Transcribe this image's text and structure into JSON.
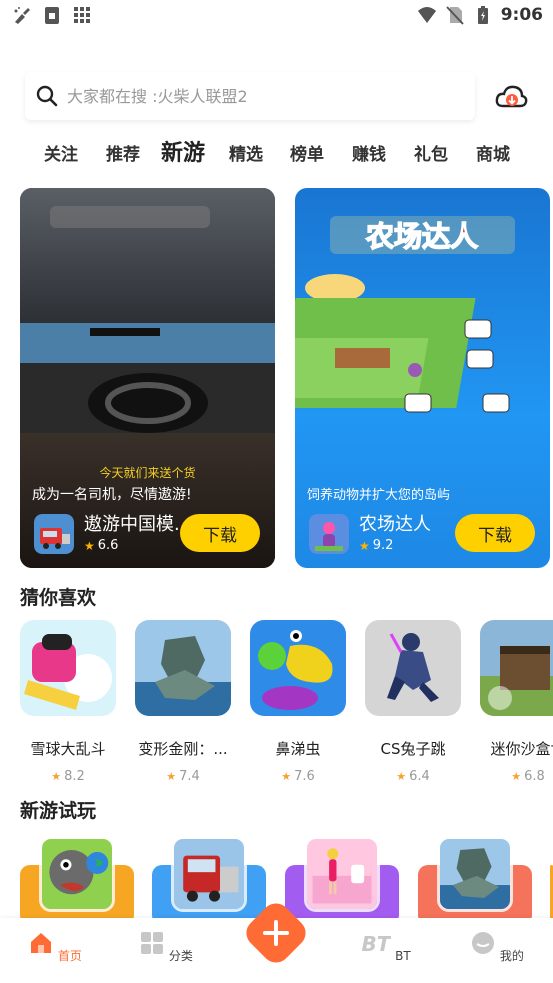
{
  "status_bar": {
    "time": "9:06",
    "left_icons": [
      "broom-icon",
      "sim-card-icon",
      "grid-icon"
    ],
    "right_icons": [
      "wifi-icon",
      "no-sim-icon",
      "battery-icon"
    ]
  },
  "search": {
    "placeholder": "大家都在搜 :火柴人联盟2",
    "icon": "search-icon",
    "right_icon": "cloud-download-icon"
  },
  "tabs": [
    {
      "label": "关注",
      "active": false
    },
    {
      "label": "推荐",
      "active": false
    },
    {
      "label": "新游",
      "active": true
    },
    {
      "label": "精选",
      "active": false
    },
    {
      "label": "榜单",
      "active": false
    },
    {
      "label": "赚钱",
      "active": false
    },
    {
      "label": "礼包",
      "active": false
    },
    {
      "label": "商城",
      "active": false
    }
  ],
  "banners": [
    {
      "overlay_text": "今天就们来送个货",
      "description": "成为一名司机，尽情遨游!",
      "app_name": "遨游中国模...",
      "rating": "6.6",
      "button": "下载"
    },
    {
      "title_art": "农场达人",
      "description": "饲养动物并扩大您的岛屿",
      "app_name": "农场达人",
      "rating": "9.2",
      "button": "下载"
    }
  ],
  "section_guess": {
    "title": "猜你喜欢",
    "games": [
      {
        "name": "雪球大乱斗",
        "rating": "8.2"
      },
      {
        "name": "变形金刚：...",
        "rating": "7.4"
      },
      {
        "name": "鼻涕虫",
        "rating": "7.6"
      },
      {
        "name": "CS兔子跳",
        "rating": "6.4"
      },
      {
        "name": "迷你沙盒世",
        "rating": "6.8"
      }
    ]
  },
  "section_trial": {
    "title": "新游试玩"
  },
  "bottom_nav": [
    {
      "label": "首页",
      "active": true
    },
    {
      "label": "分类",
      "active": false
    },
    {
      "label": "BT",
      "active": false
    },
    {
      "label": "我的",
      "active": false
    }
  ],
  "colors": {
    "accent": "#ff6b35",
    "download_button": "#ffd000",
    "star": "#f4a32d"
  }
}
